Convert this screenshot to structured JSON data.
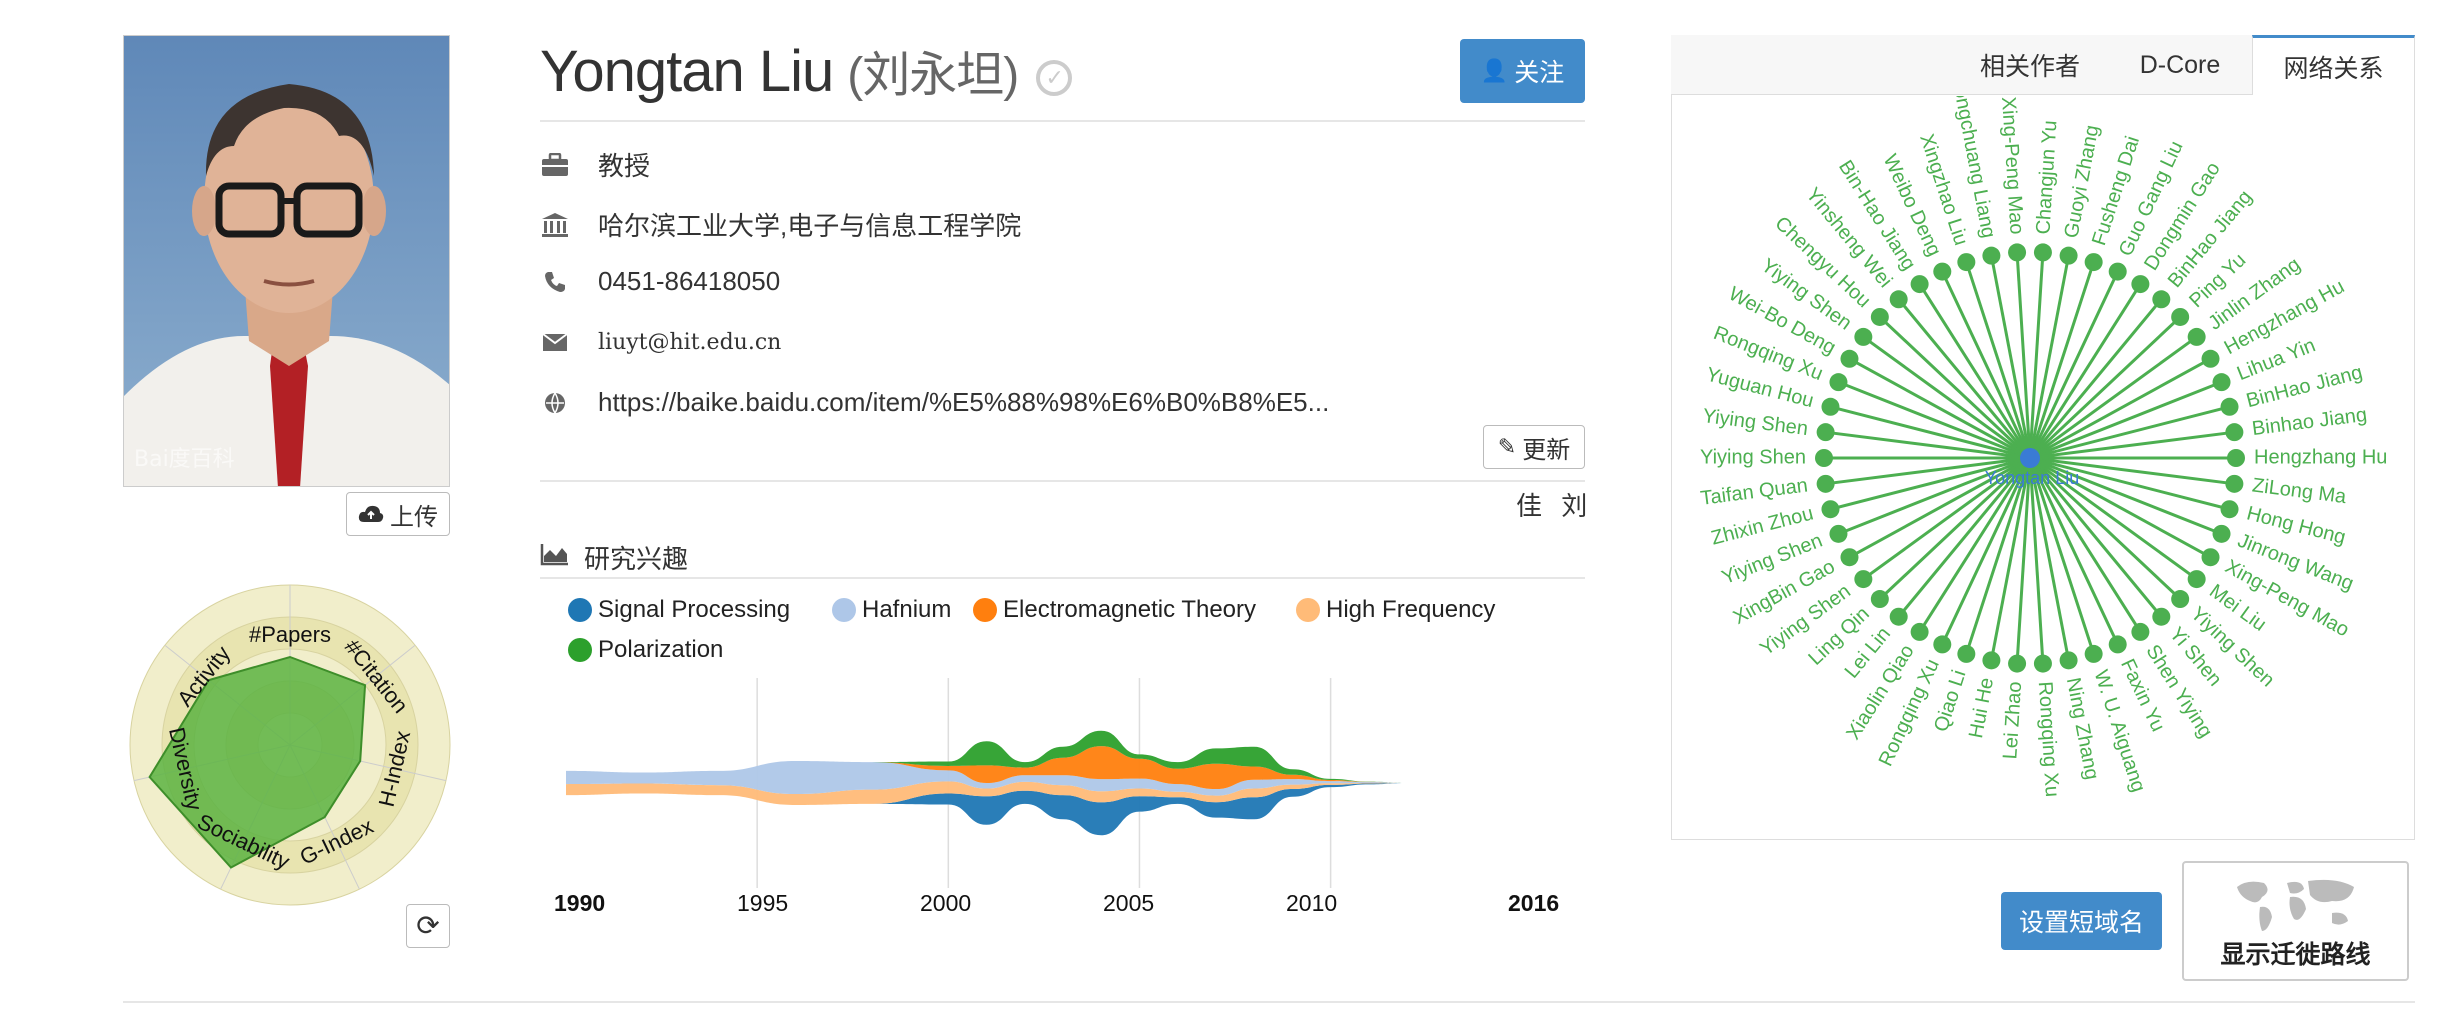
{
  "profile": {
    "name": "Yongtan Liu",
    "chinese_name": "(刘永坦)",
    "follow_label": "关注",
    "position": "教授",
    "affiliation": "哈尔滨工业大学,电子与信息工程学院",
    "phone": "0451-86418050",
    "email": "liuyt@hit.edu.cn",
    "homepage": "https://baike.baidu.com/item/%E5%88%98%E6%B0%B8%E5...",
    "update_label": "更新",
    "signature": "佳 刘",
    "upload_label": "上传",
    "photo_watermark": "Bai度百科"
  },
  "radar": {
    "axes": [
      "#Papers",
      "#Citation",
      "H-Index",
      "G-Index",
      "Sociability",
      "Diversity",
      "Activity"
    ],
    "values": [
      0.55,
      0.6,
      0.45,
      0.5,
      0.85,
      0.9,
      0.65
    ],
    "rings": 5,
    "colors": {
      "fill": "#5cb342",
      "ring_a": "#f1eecb",
      "ring_b": "#e8e4b0"
    }
  },
  "interests": {
    "title": "研究兴趣",
    "legend": [
      {
        "name": "Signal Processing",
        "color": "#1f77b4"
      },
      {
        "name": "Hafnium",
        "color": "#aec7e8"
      },
      {
        "name": "Electromagnetic Theory",
        "color": "#ff7f0e"
      },
      {
        "name": "High Frequency",
        "color": "#ffbb78"
      },
      {
        "name": "Polarization",
        "color": "#2ca02c"
      }
    ],
    "axis_start": "1990",
    "axis_end": "2016",
    "ticks": [
      "1995",
      "2000",
      "2005",
      "2010"
    ]
  },
  "chart_data": {
    "type": "area",
    "x": [
      1990,
      1992,
      1994,
      1996,
      1998,
      2000,
      2001,
      2002,
      2003,
      2004,
      2005,
      2006,
      2007,
      2008,
      2009,
      2010,
      2011,
      2012
    ],
    "series": [
      {
        "name": "Signal Processing",
        "values": [
          0,
          0,
          0,
          0,
          0,
          1.0,
          2.6,
          1.2,
          2.2,
          3.0,
          1.4,
          0.6,
          1.4,
          2.0,
          0.7,
          0.2,
          0.08,
          0
        ]
      },
      {
        "name": "Hafnium",
        "values": [
          1.2,
          1.0,
          1.3,
          3.0,
          2.5,
          1.0,
          0.5,
          0.6,
          0.9,
          1.1,
          0.9,
          0.7,
          0.6,
          0.8,
          0.5,
          0.2,
          0.08,
          0
        ]
      },
      {
        "name": "Electromagnetic Theory",
        "values": [
          0,
          0,
          0,
          0,
          0,
          0.4,
          1.6,
          0.7,
          1.6,
          3.0,
          1.8,
          1.4,
          2.3,
          1.2,
          0.4,
          0.1,
          0.02,
          0
        ]
      },
      {
        "name": "High Frequency",
        "values": [
          1.0,
          0.9,
          0.9,
          1.0,
          1.3,
          1.1,
          0.7,
          0.8,
          0.9,
          1.0,
          0.7,
          0.5,
          0.6,
          0.8,
          0.4,
          0.15,
          0.05,
          0
        ]
      },
      {
        "name": "Polarization",
        "values": [
          0,
          0,
          0,
          0,
          0,
          0.4,
          2.2,
          0.5,
          1.0,
          1.4,
          0.4,
          0.6,
          1.4,
          1.8,
          0.5,
          0.1,
          0.02,
          0
        ]
      }
    ],
    "xlim": [
      1990,
      2016
    ]
  },
  "network": {
    "tabs": [
      "相关作者",
      "D-Core",
      "网络关系"
    ],
    "active_tab": "网络关系",
    "center": "Yongtan Liu",
    "color": "#4caf50",
    "nodes": [
      "Changjun Yu",
      "Guoyi Zhang",
      "Fusheng Dai",
      "Guo Gang Liu",
      "Dongmin Gao",
      "BinHao Jiang",
      "Ping Yu",
      "Jinlin Zhang",
      "Hengzhang Hu",
      "Lihua Yin",
      "BinHao Jiang",
      "Binhao Jiang",
      "Hengzhang Hu",
      "ZiLong Ma",
      "Hong Hong",
      "Jinrong Wang",
      "Xing-Peng Mao",
      "Mei Liu",
      "Yiying Shen",
      "Yi Shen",
      "Shen Yiying",
      "Faxin Yu",
      "W. U. Aiguang",
      "Ning Zhang",
      "Rongqing Xu",
      "Lei Zhao",
      "Hui He",
      "Qiao Li",
      "Rongqing Xu",
      "Xiaolin Qiao",
      "Lei Lin",
      "Ling Qin",
      "Yiying Shen",
      "XingBin Gao",
      "Yiying Shen",
      "Zhixin Zhou",
      "Taifan Quan",
      "Yiying Shen",
      "Yiying Shen",
      "Yuguan Hou",
      "Rongqing Xu",
      "Wei-Bo Deng",
      "Yiying Shen",
      "Chengyu Hou",
      "Yinsheng Wei",
      "Bin-Hao Jiang",
      "Weibo Deng",
      "Xingzhao Liu",
      "Zongchuang Liang",
      "Xing-Peng Mao"
    ],
    "domain_label": "设置短域名",
    "migrate_label": "显示迁徙路线"
  }
}
